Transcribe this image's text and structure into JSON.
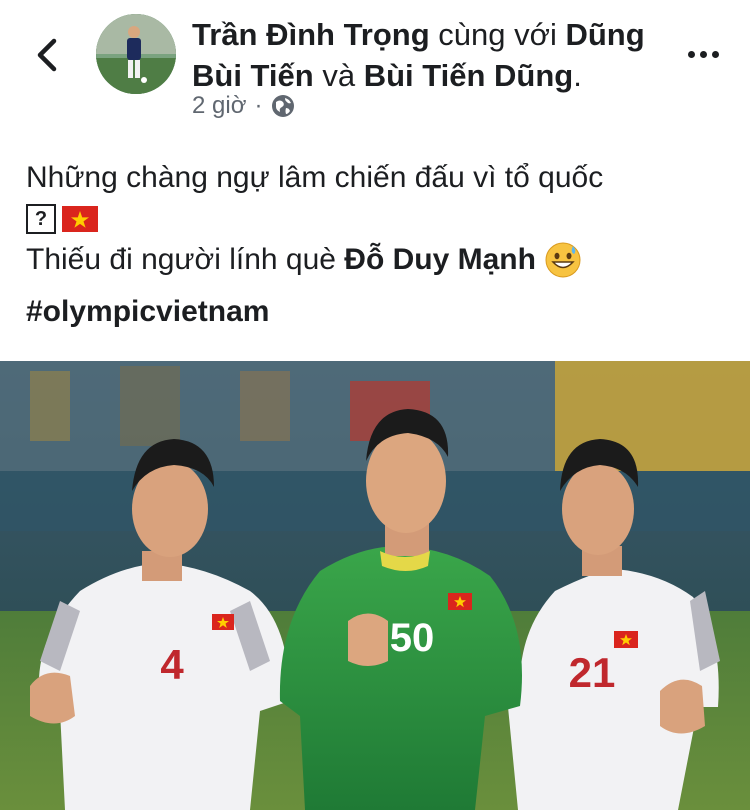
{
  "post": {
    "author": "Trần Đình Trọng",
    "with_text": "cùng với",
    "tagged_1": "Dũng Bùi Tiến",
    "and_text": "và",
    "tagged_2": "Bùi Tiến Dũng",
    "period": ".",
    "time": "2 giờ",
    "separator": "·",
    "privacy_icon": "globe-icon",
    "text_line_1": "Những chàng ngự lâm chiến đấu vì tổ quốc",
    "placeholder_glyph": "?",
    "text_line_3_prefix": "Thiếu đi người lính què ",
    "text_line_3_bold": "Đỗ Duy Mạnh",
    "hashtag": "#olympicvietnam"
  },
  "photo": {
    "jersey_numbers": [
      "4",
      "50",
      "21"
    ]
  },
  "colors": {
    "text": "#1c1e21",
    "meta": "#606770",
    "flag_red": "#da251d",
    "flag_star": "#ffcd00"
  }
}
